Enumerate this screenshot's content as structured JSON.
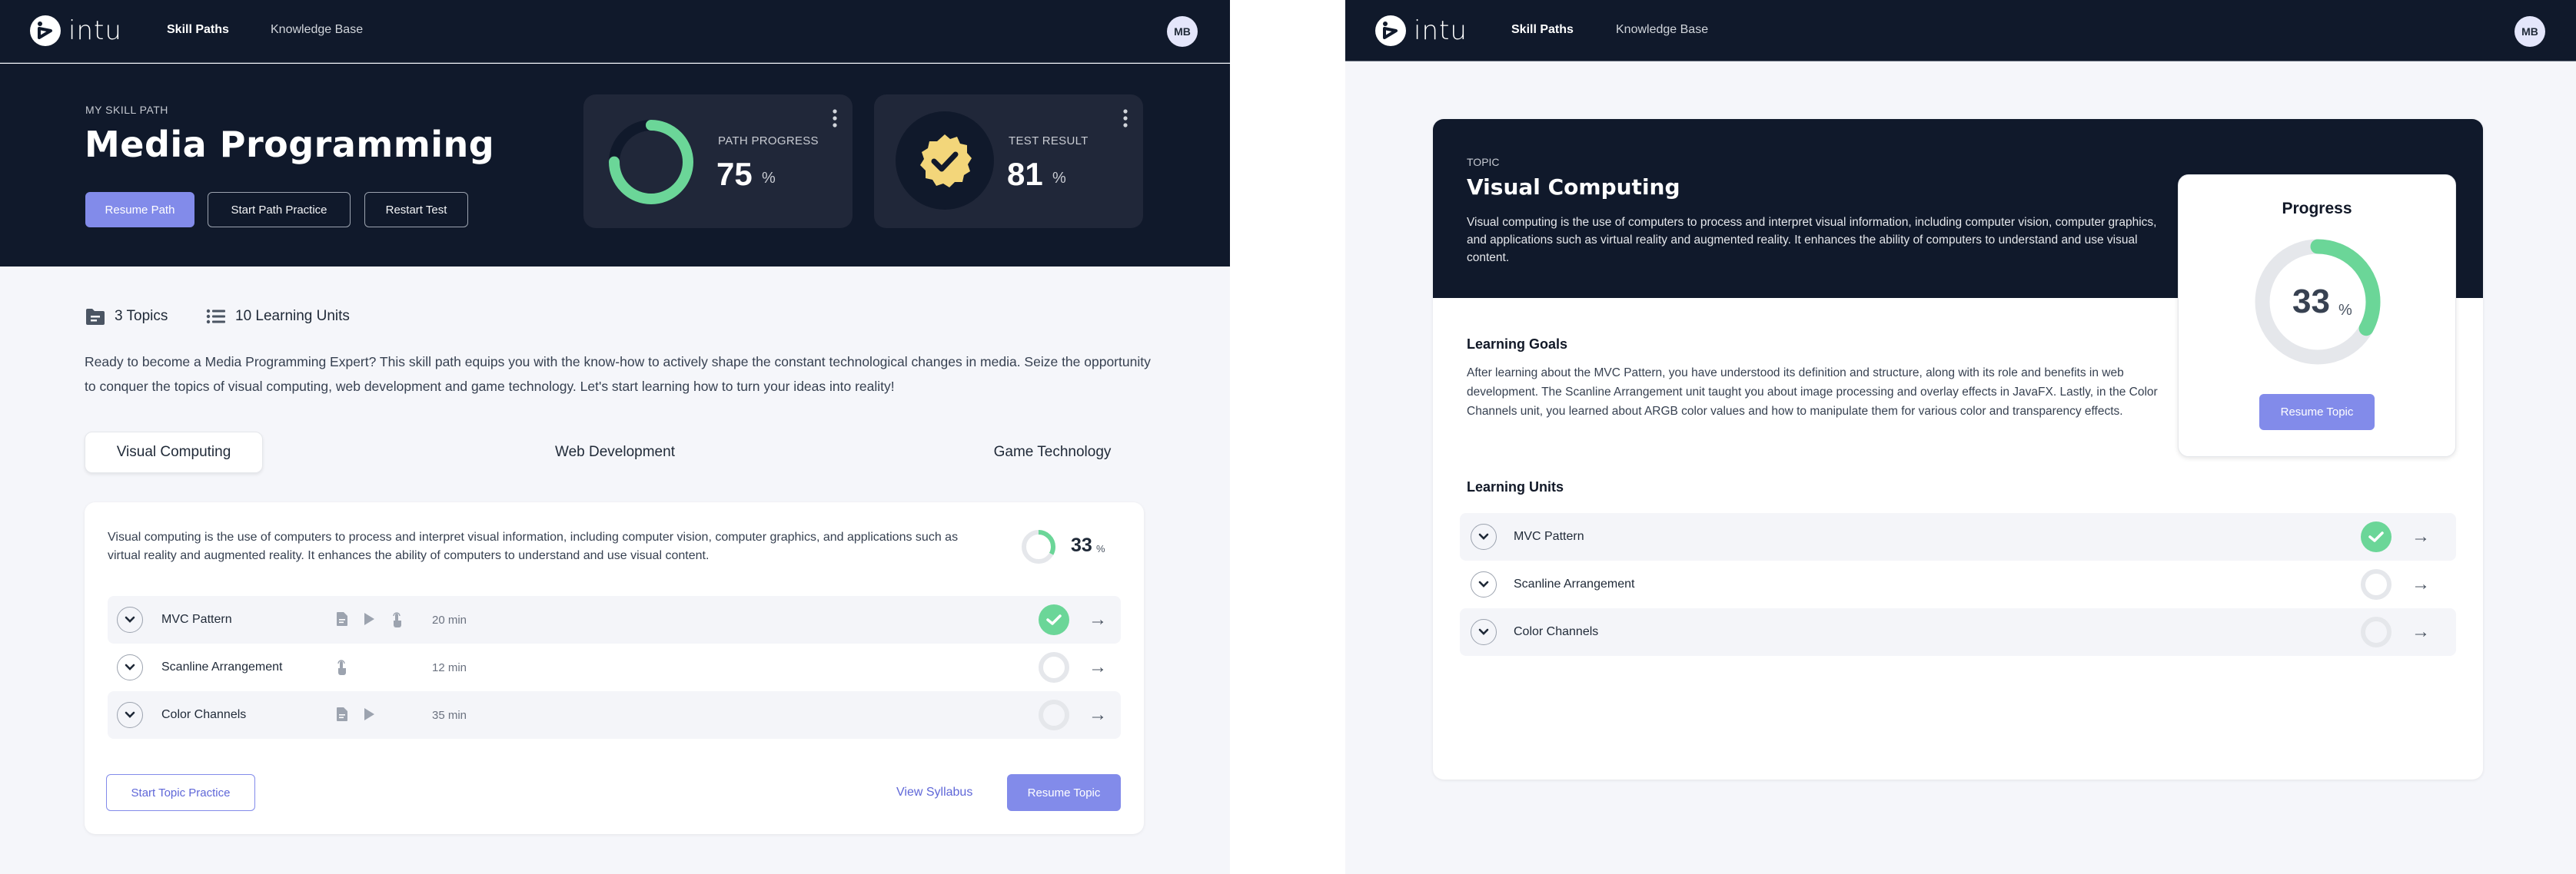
{
  "colors": {
    "navy": "#10192b",
    "card_dark": "#202739",
    "accent": "#828bea",
    "accent_text": "#5f67d8",
    "success": "#6bd698",
    "gold": "#f3d67a",
    "track_light": "#e5e7eb"
  },
  "nav": {
    "brand": "intu",
    "links": [
      {
        "label": "Skill Paths",
        "active": true
      },
      {
        "label": "Knowledge Base",
        "active": false
      }
    ],
    "avatar_initials": "MB"
  },
  "skill_path": {
    "eyebrow": "MY SKILL PATH",
    "title": "Media Programming",
    "buttons": {
      "resume": "Resume Path",
      "practice": "Start Path Practice",
      "restart": "Restart Test"
    },
    "path_progress": {
      "label": "PATH PROGRESS",
      "value": "75",
      "unit": "%",
      "fraction": 0.75
    },
    "test_result": {
      "label": "TEST RESULT",
      "value": "81",
      "unit": "%"
    },
    "meta": {
      "topics": "3 Topics",
      "units": "10 Learning Units"
    },
    "intro": "Ready to become a Media Programming Expert? This skill path equips you with the know-how to actively shape the constant technological changes in media. Seize the opportunity to conquer the topics of visual computing, web development and game technology. Let's start learning how to turn your ideas into reality!",
    "tabs": [
      {
        "label": "Visual Computing",
        "active": true
      },
      {
        "label": "Web Development",
        "active": false
      },
      {
        "label": "Game Technology",
        "active": false
      }
    ],
    "topic": {
      "description": "Visual computing is the use of computers to process and interpret visual information, including computer vision, computer graphics, and applications such as virtual reality and augmented reality. It enhances the ability of computers to understand and use visual content.",
      "progress_value": "33",
      "progress_unit": "%",
      "progress_fraction": 0.33,
      "units": [
        {
          "name": "MVC Pattern",
          "icons": [
            "document-icon",
            "play-icon",
            "touch-icon"
          ],
          "duration": "20 min",
          "status": "done"
        },
        {
          "name": "Scanline Arrangement",
          "icons": [
            "touch-icon"
          ],
          "duration": "12 min",
          "status": "todo"
        },
        {
          "name": "Color Channels",
          "icons": [
            "document-icon",
            "play-icon"
          ],
          "duration": "35 min",
          "status": "todo"
        }
      ],
      "buttons": {
        "practice": "Start Topic Practice",
        "syllabus": "View Syllabus",
        "resume": "Resume Topic"
      }
    }
  },
  "topic_page": {
    "eyebrow": "TOPIC",
    "title": "Visual Computing",
    "description": "Visual computing is the use of computers to process and interpret visual information, including computer vision, computer graphics, and applications such as virtual reality and augmented reality. It enhances the ability of computers to understand and use visual content.",
    "goals_heading": "Learning Goals",
    "goals": "After learning about the MVC Pattern, you have understood its definition and structure, along with its role and benefits in web development. The Scanline Arrangement unit taught you about image processing and overlay effects in JavaFX. Lastly, in the Color Channels unit, you learned about ARGB color values and how to manipulate them for various color and transparency effects.",
    "units_heading": "Learning Units",
    "units": [
      {
        "name": "MVC Pattern",
        "status": "done"
      },
      {
        "name": "Scanline Arrangement",
        "status": "todo"
      },
      {
        "name": "Color Channels",
        "status": "todo"
      }
    ],
    "progress": {
      "title": "Progress",
      "value": "33",
      "unit": "%",
      "fraction": 0.33,
      "button": "Resume Topic"
    }
  }
}
